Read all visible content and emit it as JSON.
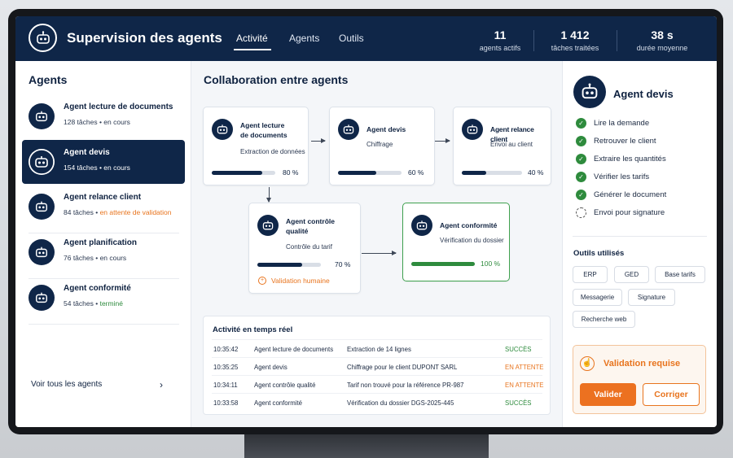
{
  "header": {
    "title": "Supervision des agents",
    "nav": [
      "Activité",
      "Agents",
      "Outils"
    ],
    "active_nav": "Activité",
    "stats": [
      {
        "value": "11",
        "label": "agents actifs"
      },
      {
        "value": "1 412",
        "label": "tâches traitées"
      },
      {
        "value": "38 s",
        "label": "durée moyenne"
      }
    ]
  },
  "left": {
    "title": "Agents",
    "agents": [
      {
        "name": "Agent lecture de documents",
        "tasks": "128 tâches",
        "status": "en cours"
      },
      {
        "name": "Agent devis",
        "tasks": "154 tâches",
        "status": "en cours"
      },
      {
        "name": "Agent relance client",
        "tasks": "84 tâches",
        "status": "en attente de validation"
      },
      {
        "name": "Agent planification",
        "tasks": "76 tâches",
        "status": "en cours"
      },
      {
        "name": "Agent conformité",
        "tasks": "54 tâches",
        "status": "terminé"
      }
    ],
    "see_all": "Voir tous les agents"
  },
  "center": {
    "title": "Collaboration entre agents",
    "nodes": [
      {
        "name_l1": "Agent lecture",
        "name_l2": "de documents",
        "sub": "Extraction de données",
        "progress": 80,
        "pct": "80 %"
      },
      {
        "name_l1": "Agent devis",
        "sub": "Chiffrage",
        "progress": 60,
        "pct": "60 %"
      },
      {
        "name_l1": "Agent relance client",
        "sub": "Envoi au client",
        "progress": 40,
        "pct": "40 %"
      },
      {
        "name_l1": "Agent contrôle",
        "name_l2": "qualité",
        "sub": "Contrôle du tarif",
        "progress": 70,
        "pct": "70 %"
      },
      {
        "name_l1": "Agent conformité",
        "sub": "Vérification du dossier",
        "progress": 100,
        "pct": "100 %"
      }
    ],
    "human_validation": "Validation humaine",
    "activity": {
      "title": "Activité en temps réel",
      "rows": [
        {
          "time": "10:35:42",
          "agent": "Agent lecture de documents",
          "action": "Extraction de 14 lignes",
          "status": "SUCCÈS"
        },
        {
          "time": "10:35:25",
          "agent": "Agent devis",
          "action": "Chiffrage pour le client DUPONT SARL",
          "status": "EN ATTENTE"
        },
        {
          "time": "10:34:11",
          "agent": "Agent contrôle qualité",
          "action": "Tarif non trouvé pour la référence PR-987",
          "status": "EN ATTENTE"
        },
        {
          "time": "10:33:58",
          "agent": "Agent conformité",
          "action": "Vérification du dossier DGS-2025-445",
          "status": "SUCCÈS"
        }
      ]
    }
  },
  "right": {
    "title": "Agent devis",
    "steps": [
      {
        "label": "Lire la demande",
        "done": true
      },
      {
        "label": "Retrouver le client",
        "done": true
      },
      {
        "label": "Extraire les quantités",
        "done": true
      },
      {
        "label": "Vérifier les tarifs",
        "done": true
      },
      {
        "label": "Générer le document",
        "done": true
      },
      {
        "label": "Envoi pour signature",
        "done": false
      }
    ],
    "tools_title": "Outils utilisés",
    "tools": [
      "ERP",
      "GED",
      "Base tarifs",
      "Messagerie",
      "Signature",
      "Recherche web"
    ],
    "validation": {
      "title": "Validation requise",
      "approve": "Valider",
      "correct": "Corriger"
    }
  },
  "colors": {
    "navy": "#0f2648",
    "accent_orange": "#ec7120",
    "success_green": "#2e8b3d"
  }
}
